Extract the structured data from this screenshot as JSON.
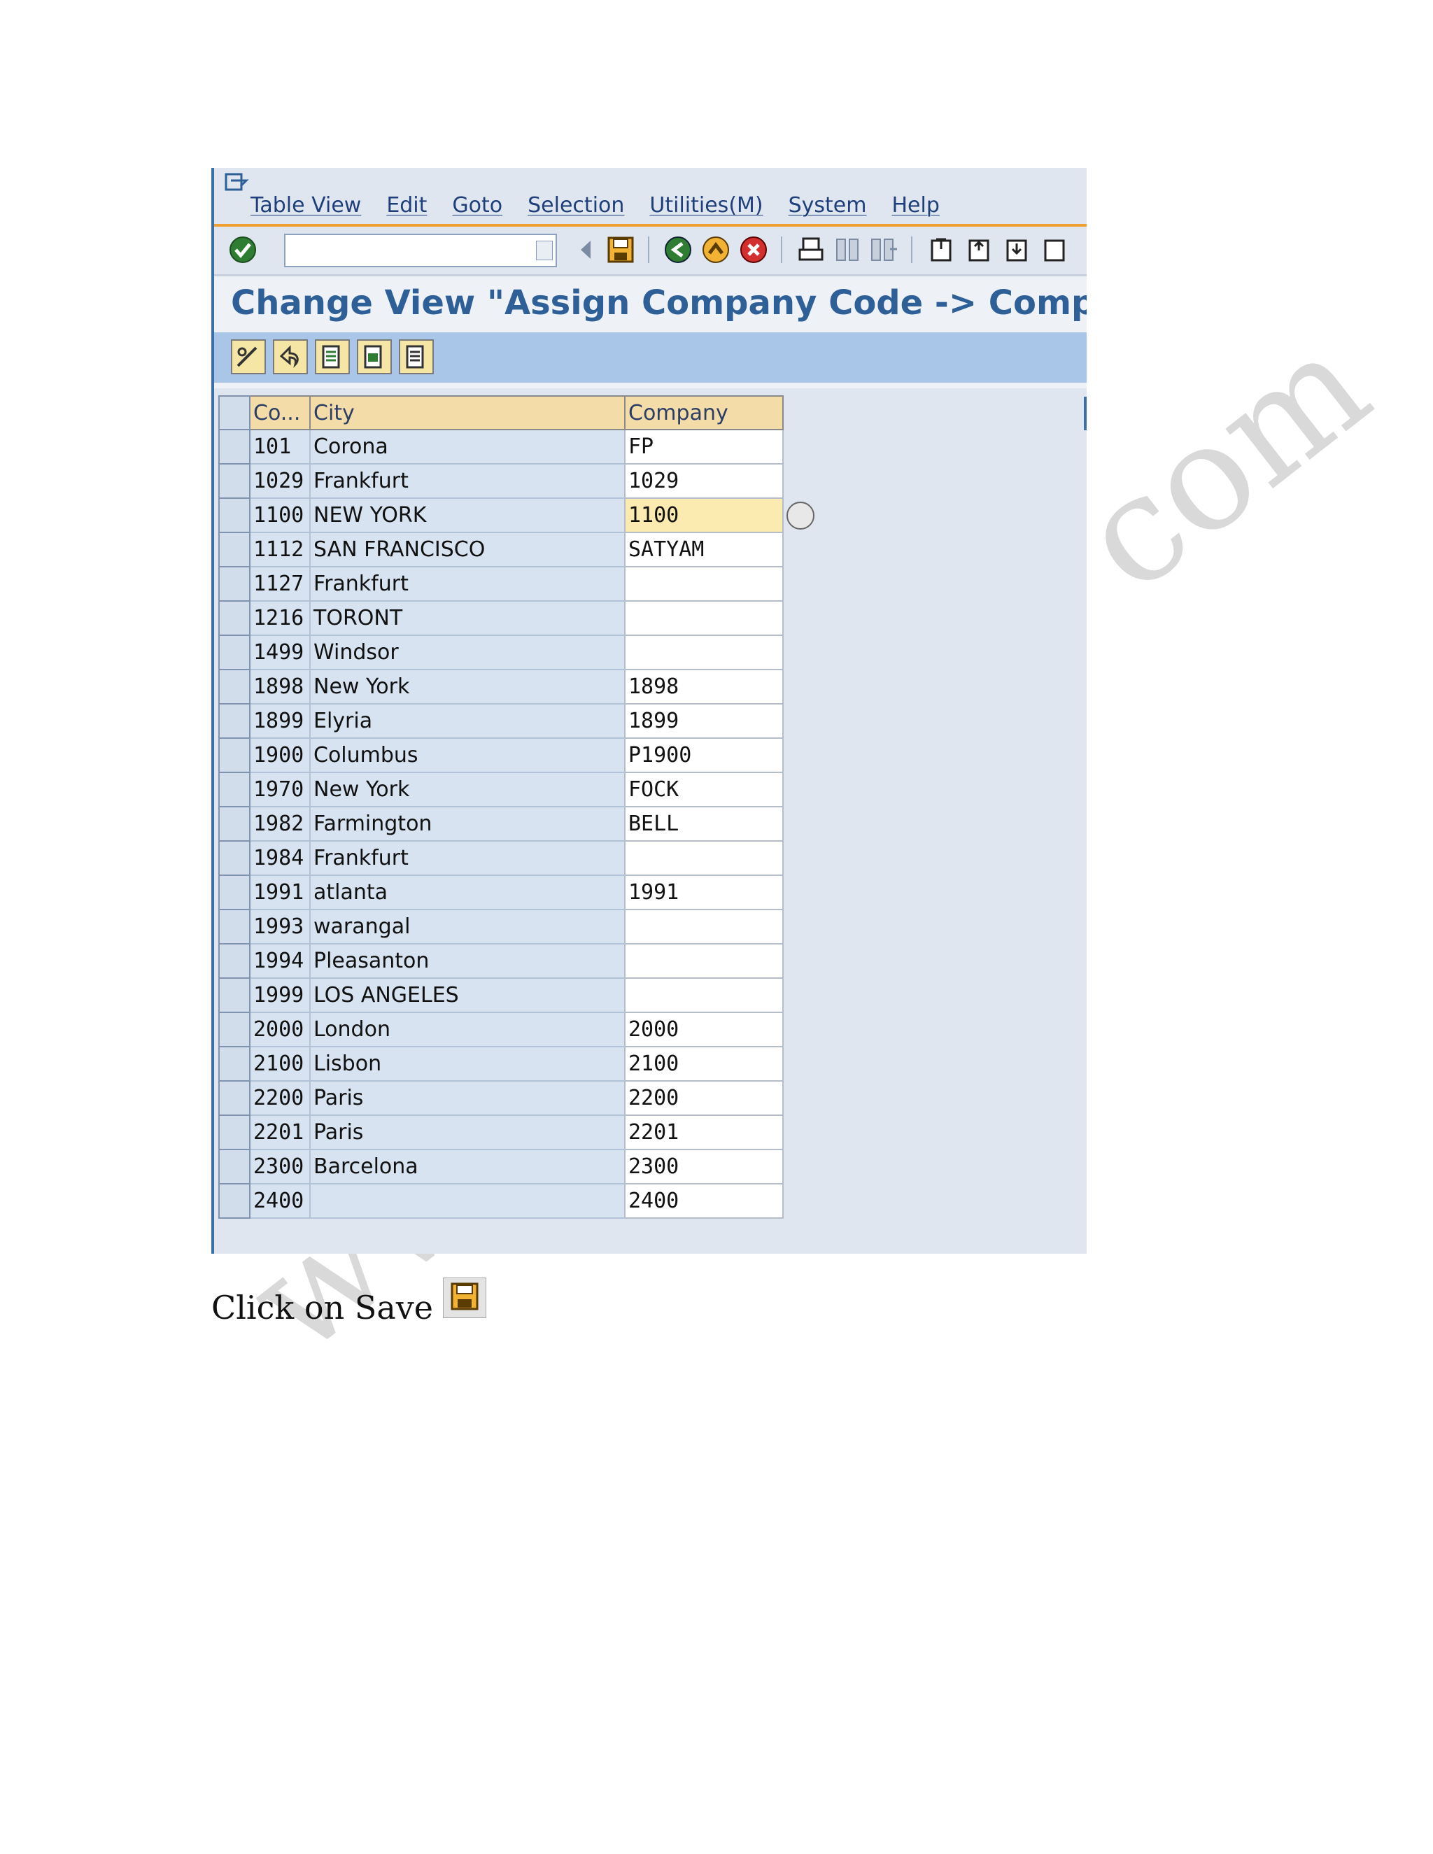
{
  "watermark": {
    "left": "www",
    "right": "com"
  },
  "menubar": {
    "items": [
      "Table View",
      "Edit",
      "Goto",
      "Selection",
      "Utilities(M)",
      "System",
      "Help"
    ]
  },
  "title": "Change View \"Assign Company Code -> Company\": ",
  "table": {
    "headers": {
      "code": "Co...",
      "city": "City",
      "company": "Company"
    },
    "active_row": 2,
    "rows": [
      {
        "code": "101",
        "city": "Corona",
        "company": "FP"
      },
      {
        "code": "1029",
        "city": "Frankfurt",
        "company": "1029"
      },
      {
        "code": "1100",
        "city": "NEW YORK",
        "company": "1100"
      },
      {
        "code": "1112",
        "city": "SAN FRANCISCO",
        "company": "SATYAM"
      },
      {
        "code": "1127",
        "city": "Frankfurt",
        "company": ""
      },
      {
        "code": "1216",
        "city": "TORONT",
        "company": ""
      },
      {
        "code": "1499",
        "city": "Windsor",
        "company": ""
      },
      {
        "code": "1898",
        "city": "New York",
        "company": "1898"
      },
      {
        "code": "1899",
        "city": "Elyria",
        "company": "1899"
      },
      {
        "code": "1900",
        "city": "Columbus",
        "company": "P1900"
      },
      {
        "code": "1970",
        "city": "New York",
        "company": "FOCK"
      },
      {
        "code": "1982",
        "city": "Farmington",
        "company": "BELL"
      },
      {
        "code": "1984",
        "city": "Frankfurt",
        "company": ""
      },
      {
        "code": "1991",
        "city": "atlanta",
        "company": "1991"
      },
      {
        "code": "1993",
        "city": "warangal",
        "company": ""
      },
      {
        "code": "1994",
        "city": "Pleasanton",
        "company": ""
      },
      {
        "code": "1999",
        "city": "LOS ANGELES",
        "company": ""
      },
      {
        "code": "2000",
        "city": "London",
        "company": "2000"
      },
      {
        "code": "2100",
        "city": "Lisbon",
        "company": "2100"
      },
      {
        "code": "2200",
        "city": "Paris",
        "company": "2200"
      },
      {
        "code": "2201",
        "city": "Paris",
        "company": "2201"
      },
      {
        "code": "2300",
        "city": "Barcelona",
        "company": "2300"
      },
      {
        "code": "2400",
        "city": "",
        "company": "2400"
      }
    ]
  },
  "caption": "Click on Save",
  "colors": {
    "accent": "#2e5f96",
    "header": "#f3dca7",
    "active_cell": "#fcebb0"
  }
}
